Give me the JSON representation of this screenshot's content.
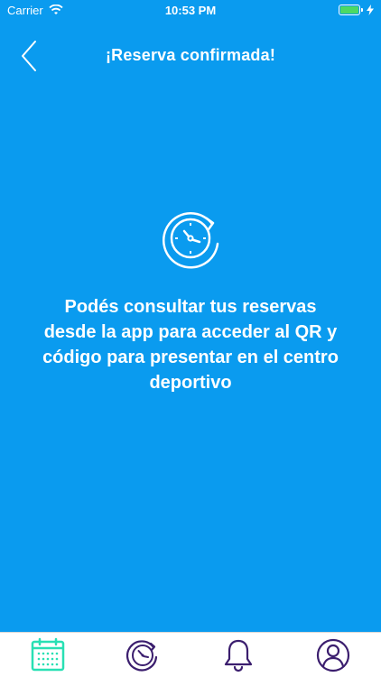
{
  "status_bar": {
    "carrier": "Carrier",
    "time": "10:53 PM",
    "battery_color": "#4cd964"
  },
  "nav": {
    "title": "¡Reserva confirmada!",
    "back_icon": "chevron-left-icon"
  },
  "hero": {
    "icon": "clock-history-icon",
    "message": "Podés consultar tus reservas desde la app para acceder al QR y código para presentar en el centro deportivo"
  },
  "tab_bar": {
    "tabs": [
      {
        "icon": "calendar-icon",
        "active": true,
        "color": "#29e0b4"
      },
      {
        "icon": "clock-history-icon",
        "active": false,
        "color": "#3b1e6e"
      },
      {
        "icon": "bell-icon",
        "active": false,
        "color": "#3b1e6e"
      },
      {
        "icon": "user-icon",
        "active": false,
        "color": "#3b1e6e"
      }
    ]
  },
  "colors": {
    "background": "#0a9bef",
    "text": "#ffffff"
  }
}
